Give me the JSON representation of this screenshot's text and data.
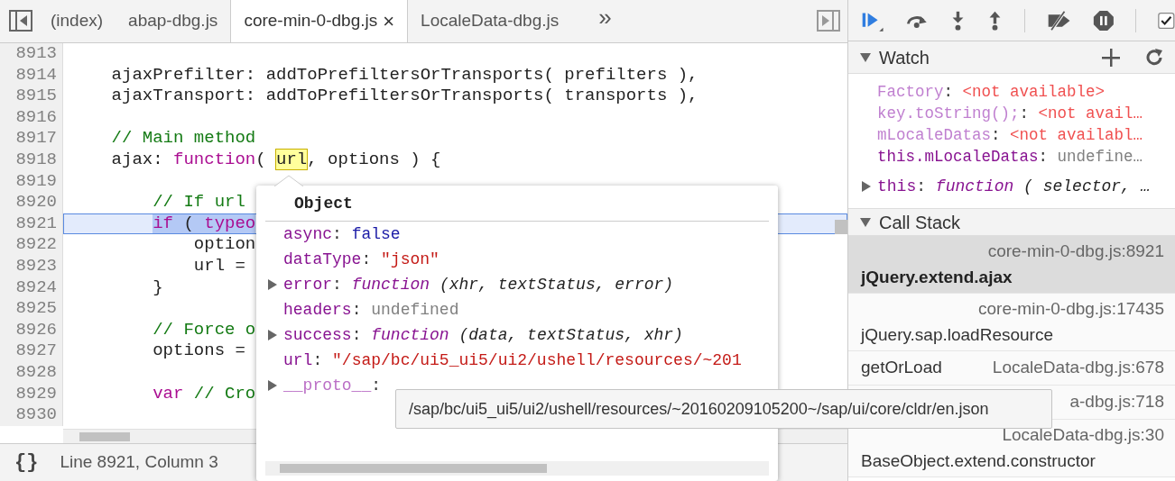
{
  "editor_tabs": {
    "items": [
      {
        "label": "(index)",
        "selected": false
      },
      {
        "label": "abap-dbg.js",
        "selected": false
      },
      {
        "label": "core-min-0-dbg.js",
        "selected": true,
        "close": "×"
      },
      {
        "label": "LocaleData-dbg.js",
        "selected": false
      }
    ],
    "overflow": "»"
  },
  "code_lines": [
    {
      "number": "8913",
      "current": false
    },
    {
      "number": "8914",
      "current": false,
      "tokens": [
        {
          "kind": "plain",
          "text": "    ajaxPrefilter: addToPrefiltersOrTransports( prefilters ),"
        }
      ]
    },
    {
      "number": "8915",
      "current": false,
      "tokens": [
        {
          "kind": "plain",
          "text": "    ajaxTransport: addToPrefiltersOrTransports( transports ),"
        }
      ]
    },
    {
      "number": "8916",
      "current": false
    },
    {
      "number": "8917",
      "current": false,
      "tokens": [
        {
          "kind": "comment",
          "text": "    // Main method"
        }
      ]
    },
    {
      "number": "8918",
      "current": false,
      "tokens": [
        {
          "kind": "plain",
          "text": "    ajax: "
        },
        {
          "kind": "keyword",
          "text": "function"
        },
        {
          "kind": "plain",
          "text": "( "
        },
        {
          "kind": "hovered",
          "text": "url"
        },
        {
          "kind": "plain",
          "text": ", options ) {"
        }
      ]
    },
    {
      "number": "8919",
      "current": false
    },
    {
      "number": "8920",
      "current": false,
      "tokens": [
        {
          "kind": "comment",
          "text": "        // If url"
        }
      ]
    },
    {
      "number": "8921",
      "current": true,
      "tokens": [
        {
          "kind": "keyword",
          "text": "        if"
        },
        {
          "kind": "plain",
          "text": " ( "
        },
        {
          "kind": "keyword",
          "text": "typeo"
        }
      ]
    },
    {
      "number": "8922",
      "current": false,
      "tokens": [
        {
          "kind": "plain",
          "text": "            option"
        }
      ]
    },
    {
      "number": "8923",
      "current": false,
      "tokens": [
        {
          "kind": "plain",
          "text": "            url ="
        }
      ]
    },
    {
      "number": "8924",
      "current": false,
      "tokens": [
        {
          "kind": "plain",
          "text": "        }"
        }
      ]
    },
    {
      "number": "8925",
      "current": false
    },
    {
      "number": "8926",
      "current": false,
      "tokens": [
        {
          "kind": "comment",
          "text": "        // Force o"
        }
      ]
    },
    {
      "number": "8927",
      "current": false,
      "tokens": [
        {
          "kind": "plain",
          "text": "        options ="
        }
      ]
    },
    {
      "number": "8928",
      "current": false
    },
    {
      "number": "8929",
      "current": false,
      "tokens": [
        {
          "kind": "keyword",
          "text": "        var"
        },
        {
          "kind": "comment",
          "text": " // Cro"
        }
      ]
    },
    {
      "number": "8930",
      "current": false
    }
  ],
  "status_bar": {
    "format_button": "{}",
    "position": "Line 8921, Column 3"
  },
  "object_popover": {
    "title": "Object",
    "properties": [
      {
        "name": "async",
        "separator": ":",
        "kind": "boolean",
        "value": "false",
        "expandable": false
      },
      {
        "name": "dataType",
        "separator": ":",
        "kind": "string",
        "value": "\"json\"",
        "expandable": false
      },
      {
        "name": "error",
        "separator": ":",
        "kind": "function",
        "value": "function",
        "detail": "(xhr, textStatus, error)",
        "expandable": true
      },
      {
        "name": "headers",
        "separator": ":",
        "kind": "undefined",
        "value": "undefined",
        "expandable": false
      },
      {
        "name": "success",
        "separator": ":",
        "kind": "function",
        "value": "function",
        "detail": "(data, textStatus, xhr)",
        "expandable": true
      },
      {
        "name": "url",
        "separator": ":",
        "kind": "string",
        "value": "\"/sap/bc/ui5_ui5/ui2/ushell/resources/~201",
        "expandable": false
      },
      {
        "name": "__proto__",
        "separator": ":",
        "kind": "internal",
        "expandable": true
      }
    ]
  },
  "tooltip": "/sap/bc/ui5_ui5/ui2/ushell/resources/~20160209105200~/sap/ui/core/cldr/en.json",
  "debugger_toolbar": {
    "checkbox": {
      "checked": true
    }
  },
  "watch": {
    "title": "Watch",
    "expanded": true,
    "items": [
      {
        "kind": "unavailable",
        "name": "Factory",
        "separator": ":",
        "value": "<not available>"
      },
      {
        "kind": "unavailable",
        "name": "key.toString();",
        "separator": ":",
        "value": "<not avail…"
      },
      {
        "kind": "unavailable",
        "name": "mLocaleDatas",
        "separator": ":",
        "value": "<not availabl…"
      },
      {
        "kind": "value",
        "name": "this.mLocaleDatas",
        "separator": ":",
        "value": "undefine…"
      },
      {
        "kind": "object",
        "name": "this",
        "separator": ":",
        "value": "function",
        "detail": "( selector, …"
      }
    ]
  },
  "call_stack": {
    "title": "Call Stack",
    "expanded": true,
    "frames": [
      {
        "kind": "stacked",
        "location": "core-min-0-dbg.js:8921",
        "function": "jQuery.extend.ajax",
        "selected": true
      },
      {
        "kind": "stacked",
        "location": "core-min-0-dbg.js:17435",
        "function": "jQuery.sap.loadResource",
        "selected": false
      },
      {
        "kind": "inline",
        "location": "LocaleData-dbg.js:678",
        "function": "getOrLoad",
        "selected": false
      },
      {
        "kind": "inline",
        "location": "a-dbg.js:718",
        "selected": false
      },
      {
        "kind": "stacked",
        "location": "LocaleData-dbg.js:30",
        "function": "BaseObject.extend.constructor",
        "selected": false
      }
    ]
  }
}
